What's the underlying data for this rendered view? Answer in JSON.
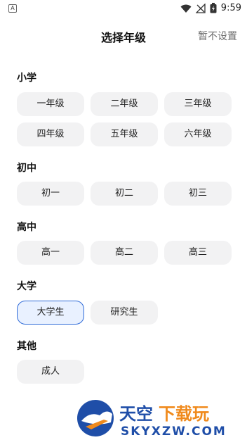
{
  "status_bar": {
    "time": "9:59",
    "left_badge": "A"
  },
  "header": {
    "title": "选择年级",
    "skip_label": "暂不设置"
  },
  "sections": [
    {
      "title": "小学",
      "items": [
        "一年级",
        "二年级",
        "三年级",
        "四年级",
        "五年级",
        "六年级"
      ]
    },
    {
      "title": "初中",
      "items": [
        "初一",
        "初二",
        "初三"
      ]
    },
    {
      "title": "高中",
      "items": [
        "高一",
        "高二",
        "高三"
      ]
    },
    {
      "title": "大学",
      "items": [
        "大学生",
        "研究生"
      ],
      "selected": "大学生"
    },
    {
      "title": "其他",
      "items": [
        "成人"
      ]
    }
  ],
  "watermark": {
    "text": "天空下载玩",
    "url": "SKYXZW.COM"
  },
  "colors": {
    "accent": "#2f6bd8",
    "chip_bg": "#f2f2f3",
    "selected_bg": "#e9f1ff"
  }
}
